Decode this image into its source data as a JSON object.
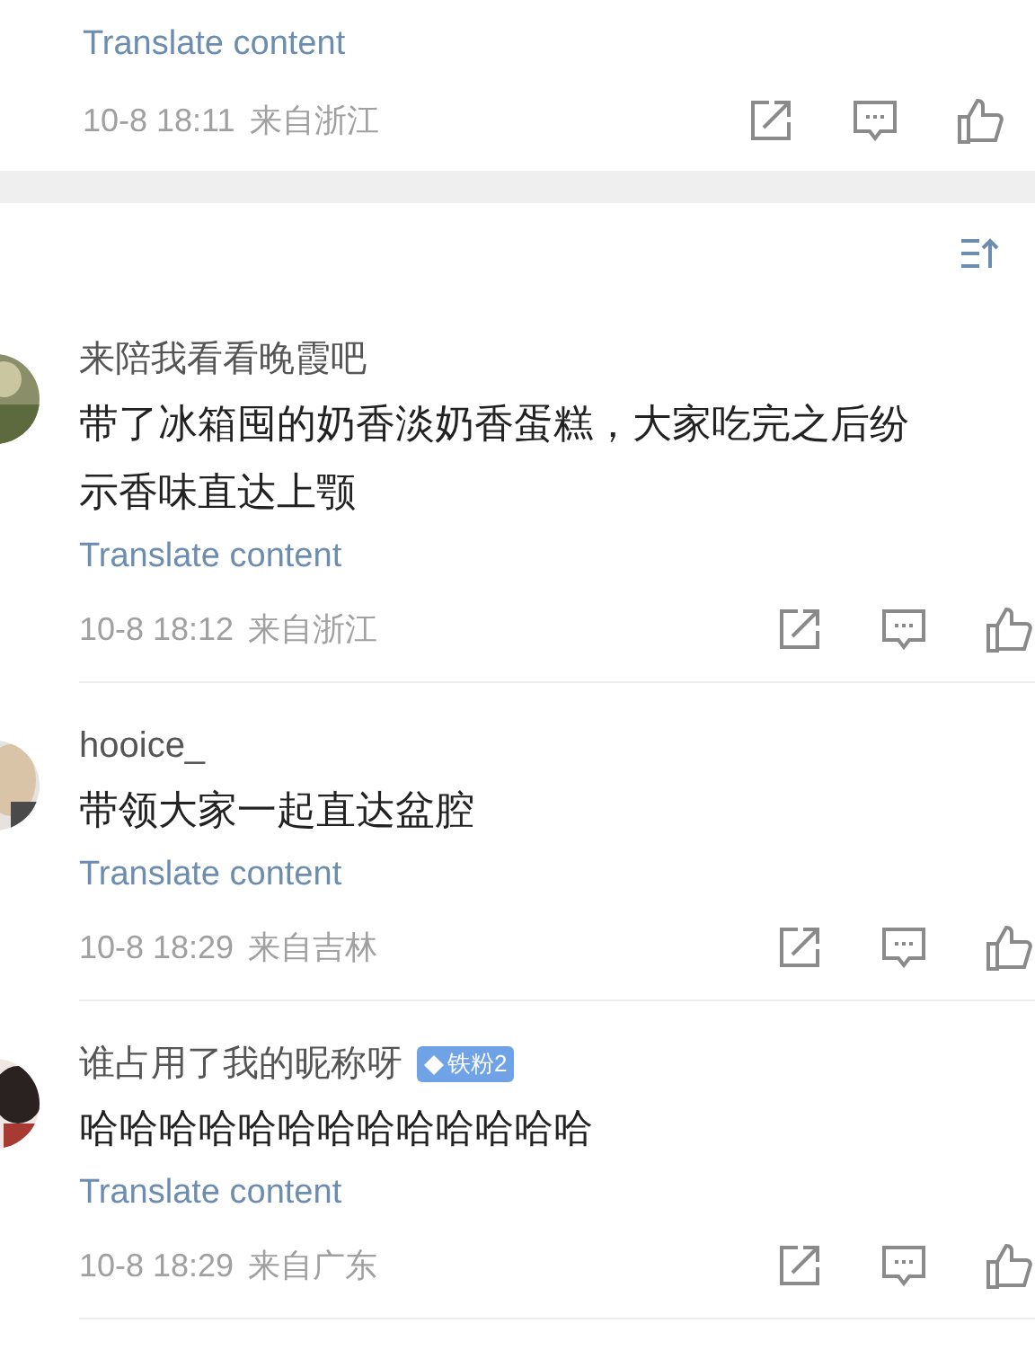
{
  "top_comment": {
    "translate_link": "Translate content",
    "time": "10-8 18:11",
    "location": "来自浙江"
  },
  "comments": [
    {
      "username": "来陪我看看晚霞吧",
      "lines": [
        "带了冰箱囤的奶香淡奶香蛋糕，大家吃完之后纷",
        "示香味直达上颚"
      ],
      "translate_link": "Translate content",
      "time": "10-8 18:12",
      "location": "来自浙江"
    },
    {
      "username": "hooice_",
      "lines": [
        "带领大家一起直达盆腔"
      ],
      "translate_link": "Translate content",
      "time": "10-8 18:29",
      "location": "来自吉林"
    },
    {
      "username": "谁占用了我的昵称呀",
      "badge": "铁粉2",
      "lines": [
        "哈哈哈哈哈哈哈哈哈哈哈哈哈"
      ],
      "translate_link": "Translate content",
      "time": "10-8 18:29",
      "location": "来自广东"
    }
  ]
}
